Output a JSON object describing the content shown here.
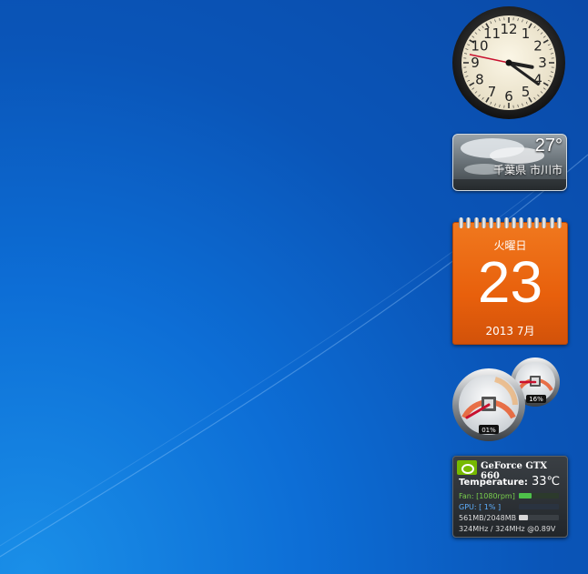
{
  "desktop": {
    "clock": {
      "hour": 3,
      "minute": 21,
      "second": 47
    },
    "weather": {
      "temperature": "27°",
      "location": "千葉県 市川市"
    },
    "calendar": {
      "weekday": "火曜日",
      "day": "23",
      "year_month": "2013 7月"
    },
    "meters": {
      "cpu_percent": "01%",
      "memory_percent": "16%",
      "cpu_level": 0.01,
      "memory_level": 0.16
    },
    "gpu": {
      "name": "GeForce GTX 660",
      "temperature_label": "Temperature:",
      "temperature_value": "33℃",
      "fan": "Fan: [1080rpm]",
      "gpu_usage": "GPU: [ 1% ]",
      "memory": "561MB/2048MB",
      "clocks": "324MHz / 324MHz @0.89V",
      "accent_color": "#76b900"
    },
    "colors": {
      "wallpaper": "#0a55b8",
      "calendar": "#e8600c"
    }
  }
}
